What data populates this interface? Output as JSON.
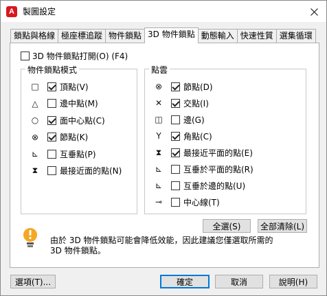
{
  "window": {
    "title": "製圖設定",
    "app_icon_letter": "A"
  },
  "tabs": [
    {
      "label": "鎖點與格線",
      "active": false
    },
    {
      "label": "極座標追蹤",
      "active": false
    },
    {
      "label": "物件鎖點",
      "active": false
    },
    {
      "label": "3D 物件鎖點",
      "active": true
    },
    {
      "label": "動態輸入",
      "active": false
    },
    {
      "label": "快速性質",
      "active": false
    },
    {
      "label": "選集循環",
      "active": false
    }
  ],
  "master_toggle": {
    "label": "3D 物件鎖點打開(O) (F4)",
    "checked": false
  },
  "groups": {
    "left": {
      "title": "物件鎖點模式",
      "items": [
        {
          "symbol": "□",
          "label": "頂點(V)",
          "checked": true
        },
        {
          "symbol": "△",
          "label": "邊中點(M)",
          "checked": false
        },
        {
          "symbol": "○",
          "label": "面中心點(C)",
          "checked": true
        },
        {
          "symbol": "⊗",
          "label": "節點(K)",
          "checked": true
        },
        {
          "symbol": "⊾",
          "label": "互垂點(P)",
          "checked": false
        },
        {
          "symbol": "⧗",
          "label": "最接近面的點(N)",
          "checked": false
        }
      ]
    },
    "right": {
      "title": "點雲",
      "items": [
        {
          "symbol": "⊗",
          "label": "節點(D)",
          "checked": true
        },
        {
          "symbol": "✕",
          "label": "交點(I)",
          "checked": true
        },
        {
          "symbol": "◫",
          "label": "邊(G)",
          "checked": false
        },
        {
          "symbol": "Y",
          "label": "角點(C)",
          "checked": true
        },
        {
          "symbol": "⧗",
          "label": "最接近平面的點(E)",
          "checked": true
        },
        {
          "symbol": "⊾",
          "label": "互垂於平面的點(R)",
          "checked": false
        },
        {
          "symbol": "⊾",
          "label": "互垂於邊的點(U)",
          "checked": false
        },
        {
          "symbol": "⊸",
          "label": "中心線(T)",
          "checked": false
        }
      ]
    }
  },
  "buttons": {
    "select_all": "全選(S)",
    "clear_all": "全部清除(L)",
    "options": "選項(T)...",
    "ok": "確定",
    "cancel": "取消",
    "help": "說明(H)"
  },
  "info": {
    "line1": "由於 3D 物件鎖點可能會降低效能，因此建議您僅選取所需的",
    "line2": "3D 物件鎖點。"
  },
  "colors": {
    "app_icon": "#d7191f",
    "info_bulb": "#f5a623",
    "default_button_border": "#0078d7"
  }
}
